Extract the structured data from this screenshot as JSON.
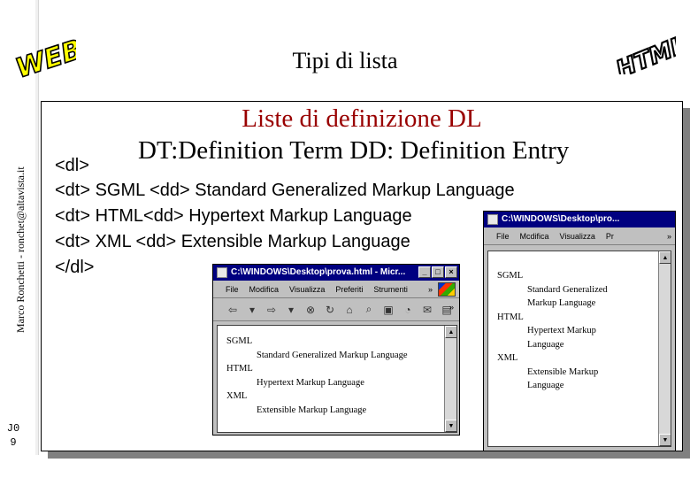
{
  "slide": {
    "title": "Tipi di lista",
    "logo_left": "WEB",
    "logo_right": "HTML",
    "author": "Marco Ronchetti - ronchet@altavista.it",
    "page_number": "J0 9"
  },
  "content": {
    "heading1": "Liste di definizione DL",
    "heading2": "DT:Definition Term   DD: Definition Entry",
    "code_lines": [
      "<dl>",
      "<dt> SGML <dd> Standard Generalized Markup Language",
      "<dt> HTML<dd> Hypertext Markup Language",
      "<dt> XML <dd> Extensible Markup Language",
      "</dl>"
    ]
  },
  "browser_main": {
    "title": "C:\\WINDOWS\\Desktop\\prova.html - Micr...",
    "menu": [
      "File",
      "Modifica",
      "Visualizza",
      "Preferiti",
      "Strumenti"
    ],
    "menu_more": "»",
    "toolbar_more": "»",
    "doc": [
      {
        "term": "SGML",
        "def": "Standard Generalized Markup Language"
      },
      {
        "term": "HTML",
        "def": "Hypertext Markup Language"
      },
      {
        "term": "XML",
        "def": "Extensible Markup Language"
      }
    ]
  },
  "browser_narrow": {
    "title": "C:\\WINDOWS\\Desktop\\pro...",
    "menu": [
      "File",
      "Mcdifica",
      "Visualizza",
      "Pr"
    ],
    "menu_more": "»",
    "doc_lines": [
      {
        "kind": "dt",
        "text": "SGML"
      },
      {
        "kind": "dd",
        "text": "Standard Generalized"
      },
      {
        "kind": "dd",
        "text": "Markup Language"
      },
      {
        "kind": "dt",
        "text": "HTML"
      },
      {
        "kind": "dd",
        "text": "Hypertext Markup"
      },
      {
        "kind": "dd",
        "text": "Language"
      },
      {
        "kind": "dt",
        "text": "XML"
      },
      {
        "kind": "dd",
        "text": "Extensible Markup"
      },
      {
        "kind": "dd",
        "text": "Language"
      }
    ]
  },
  "colors": {
    "heading": "#990000",
    "titlebar": "#000080",
    "logo_fill": "#ffff00"
  }
}
